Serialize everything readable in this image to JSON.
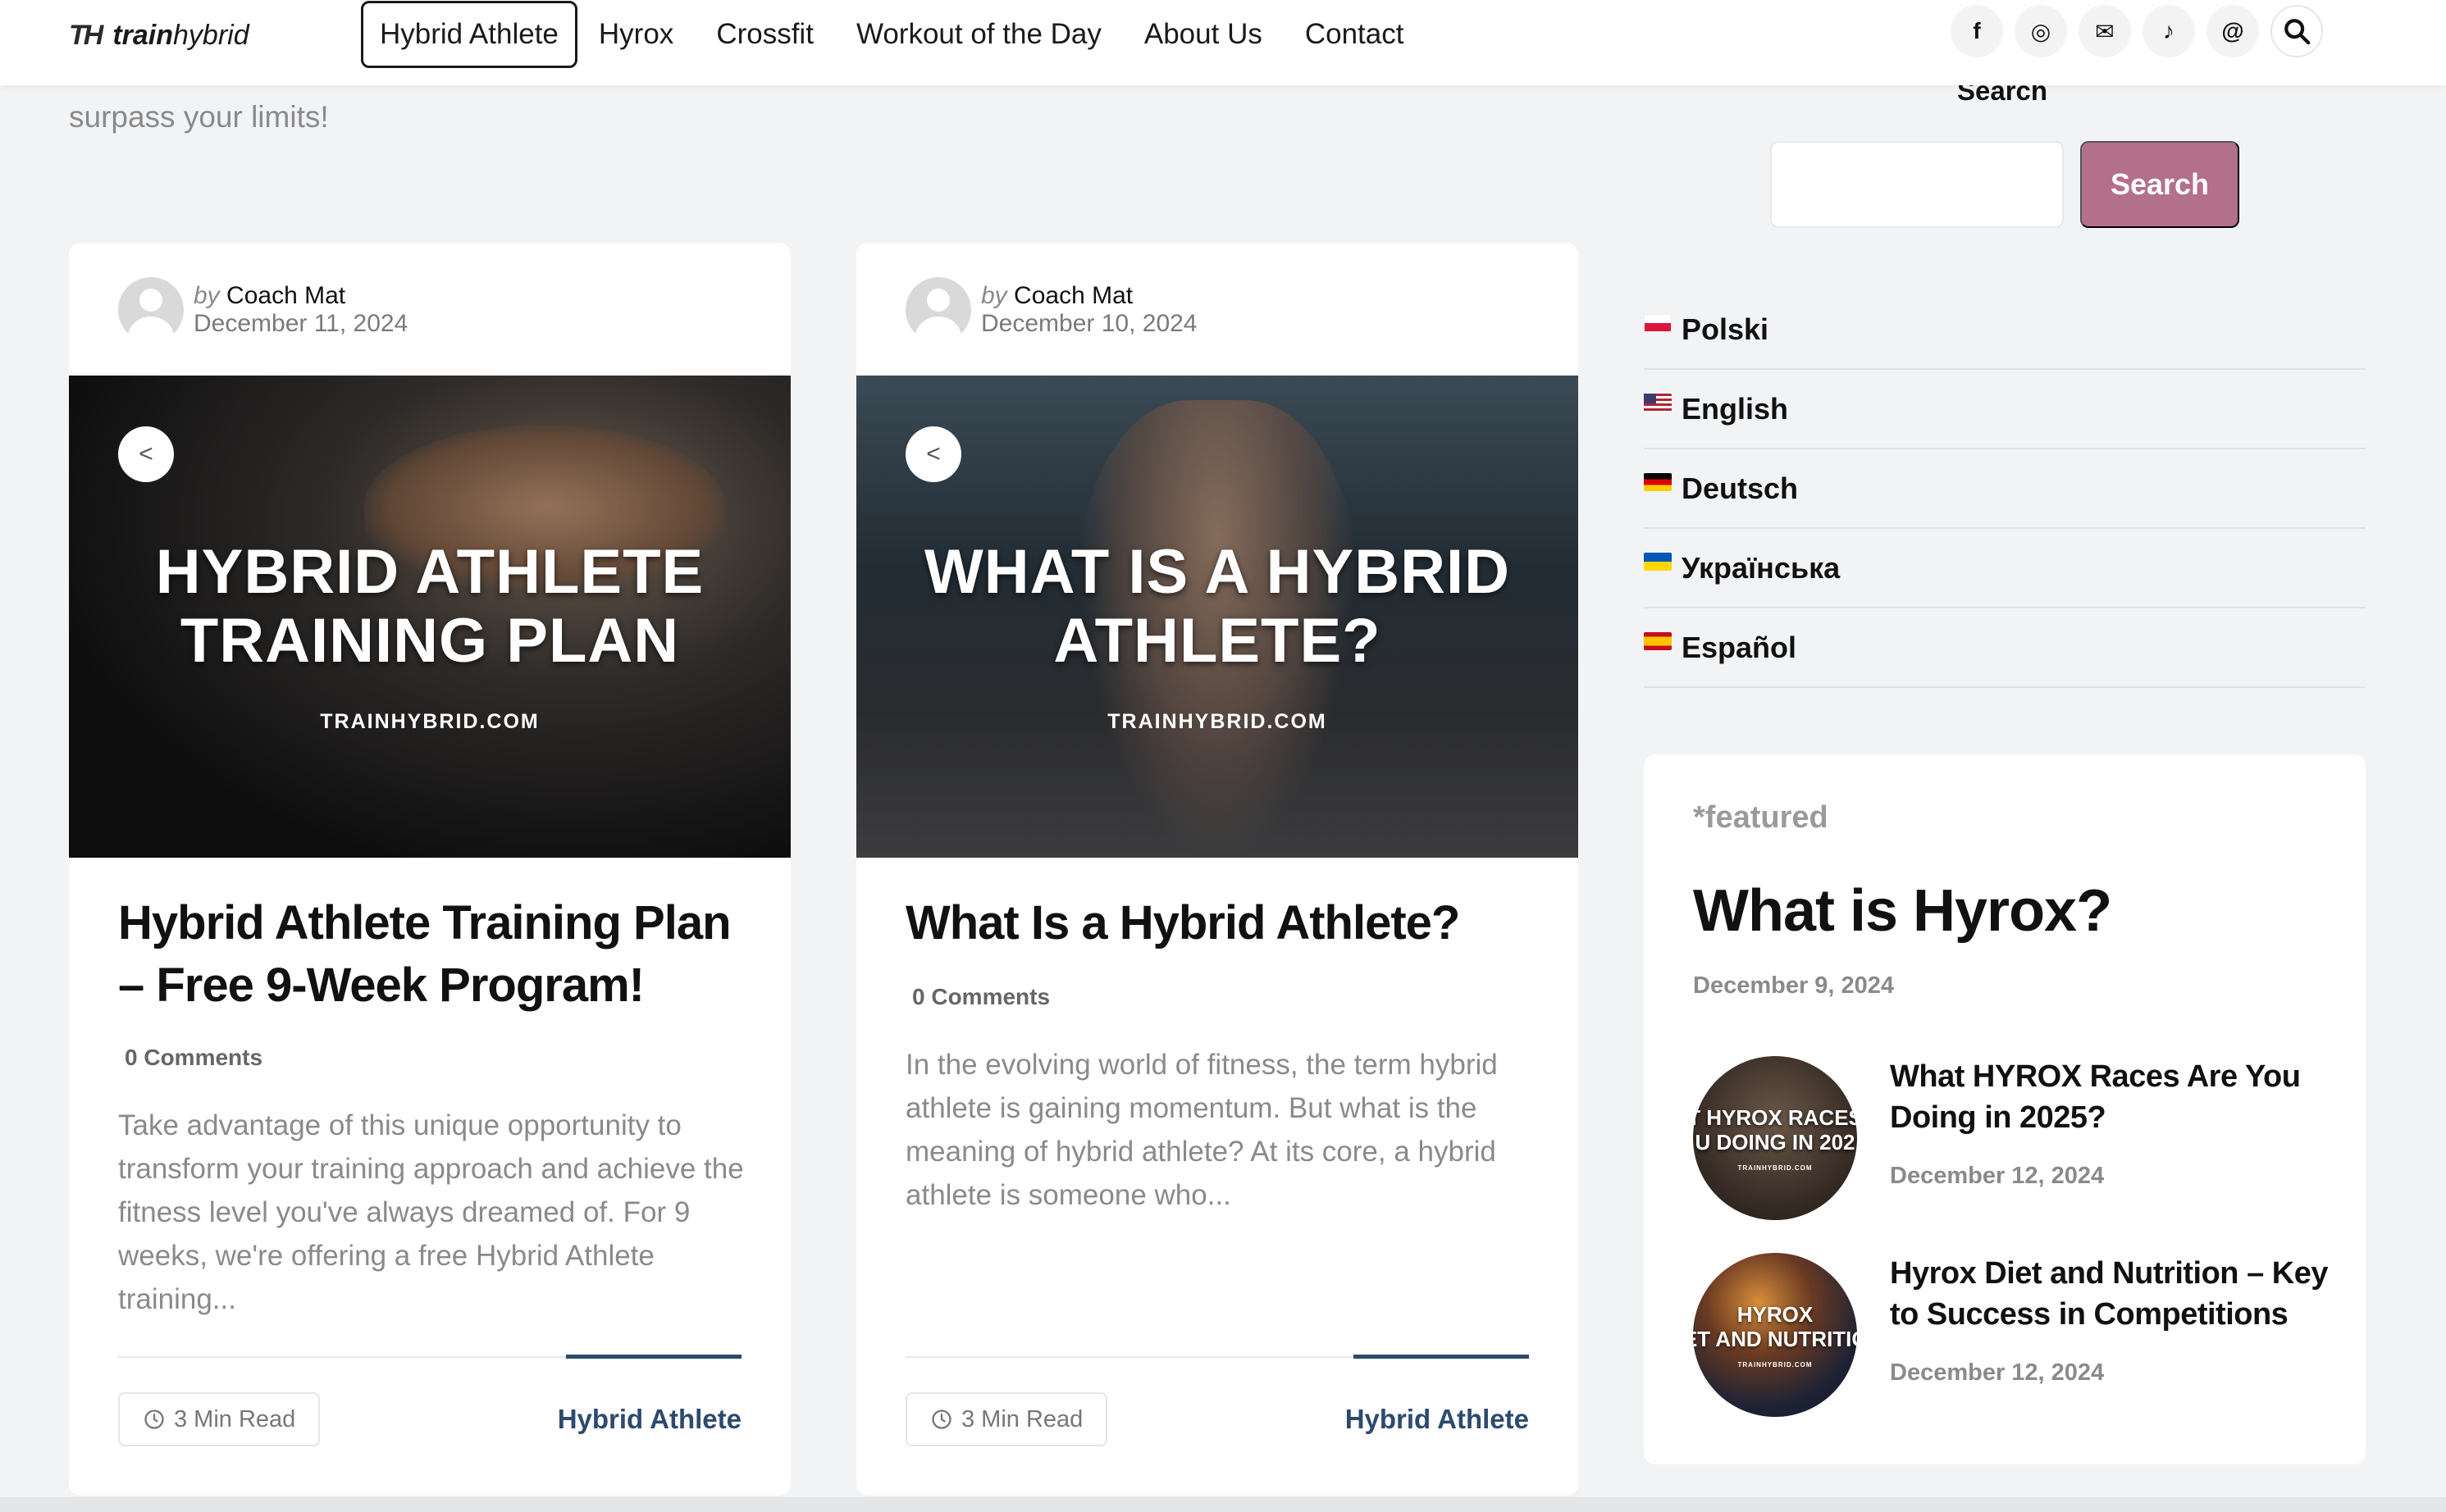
{
  "brand": {
    "mark": "TH",
    "name_bold": "train",
    "name_thin": "hybrid"
  },
  "nav": {
    "items": [
      {
        "label": "Hybrid Athlete",
        "active": true
      },
      {
        "label": "Hyrox"
      },
      {
        "label": "Crossfit"
      },
      {
        "label": "Workout of the Day"
      },
      {
        "label": "About Us"
      },
      {
        "label": "Contact"
      }
    ]
  },
  "social": [
    {
      "icon": "facebook-icon",
      "glyph": "f"
    },
    {
      "icon": "instagram-icon",
      "glyph": "◎"
    },
    {
      "icon": "email-icon",
      "glyph": "✉"
    },
    {
      "icon": "tiktok-icon",
      "glyph": "♪"
    },
    {
      "icon": "threads-icon",
      "glyph": "@"
    },
    {
      "icon": "search-icon",
      "glyph": "⌕"
    }
  ],
  "intro_text": "surpass your limits!",
  "posts": [
    {
      "by": "by",
      "author": "Coach Mat",
      "date": "December 11, 2024",
      "image_title_line1": "HYBRID ATHLETE",
      "image_title_line2": "TRAINING PLAN",
      "image_site": "TRAINHYBRID.COM",
      "title": "Hybrid Athlete Training Plan – Free 9-Week Program!",
      "comments": "0 Comments",
      "excerpt": "Take advantage of this unique opportunity to transform your training approach and achieve the fitness level you've always dreamed of. For 9 weeks, we're offering a free Hybrid Athlete training...",
      "read_time": "3 Min Read",
      "category": "Hybrid Athlete"
    },
    {
      "by": "by",
      "author": "Coach Mat",
      "date": "December 10, 2024",
      "image_title_line1": "WHAT IS A HYBRID",
      "image_title_line2": "ATHLETE?",
      "image_site": "TRAINHYBRID.COM",
      "title": "What Is a Hybrid Athlete?",
      "comments": "0 Comments",
      "excerpt": "In the evolving world of fitness, the term hybrid athlete is gaining momentum. But what is the meaning of hybrid athlete? At its core, a hybrid athlete is someone who...",
      "read_time": "3 Min Read",
      "category": "Hybrid Athlete"
    }
  ],
  "sidebar": {
    "search_label": "Search",
    "search_placeholder": "",
    "search_button": "Search",
    "languages": [
      "Polski",
      "English",
      "Deutsch",
      "Українська",
      "Español"
    ],
    "featured": {
      "tag": "*featured",
      "title": "What is Hyrox?",
      "date": "December 9, 2024",
      "posts": [
        {
          "title": "What HYROX Races Are You Doing in 2025?",
          "date": "December 12, 2024",
          "thumb_line1": "T HYROX RACES",
          "thumb_line2": "U DOING IN 202",
          "thumb_site": "TRAINHYBRID.COM"
        },
        {
          "title": "Hyrox Diet and Nutrition – Key to Success in Competitions",
          "date": "December 12, 2024",
          "thumb_line1": "HYROX",
          "thumb_line2": "ET AND NUTRITIC",
          "thumb_site": "TRAINHYBRID.COM"
        }
      ]
    }
  },
  "colors": {
    "accent": "#b3708a",
    "link": "#2d4a6e",
    "background": "#f2f3f5"
  }
}
